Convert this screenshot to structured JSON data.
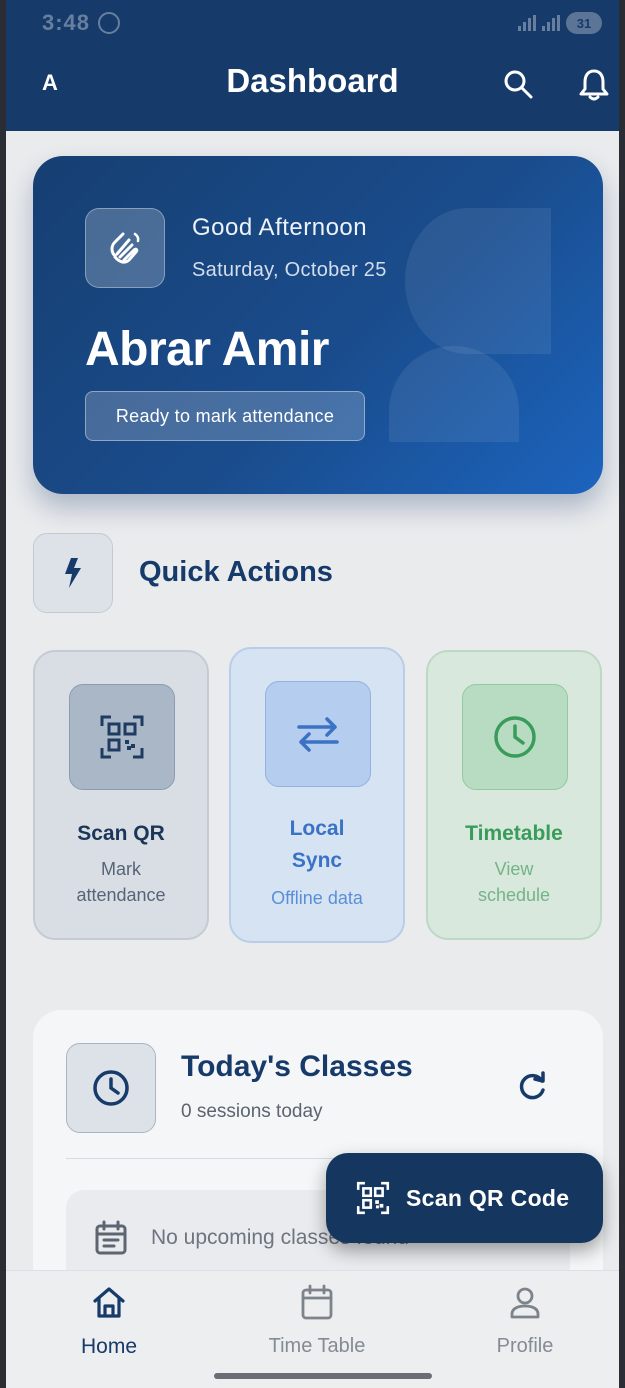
{
  "status_bar": {
    "time": "3:48",
    "battery": "31"
  },
  "app_bar": {
    "avatar_letter": "A",
    "title": "Dashboard"
  },
  "hero": {
    "greeting": "Good Afternoon",
    "date": "Saturday, October 25",
    "name": "Abrar Amir",
    "status_chip": "Ready to mark attendance"
  },
  "quick_actions": {
    "title": "Quick Actions",
    "items": [
      {
        "title": "Scan QR",
        "subtitle_line1": "Mark",
        "subtitle_line2": "attendance",
        "icon": "qr-scan-icon"
      },
      {
        "title_line1": "Local",
        "title_line2": "Sync",
        "subtitle": "Offline data",
        "icon": "sync-arrows-icon"
      },
      {
        "title": "Timetable",
        "subtitle_line1": "View",
        "subtitle_line2": "schedule",
        "icon": "clock-icon"
      }
    ]
  },
  "classes": {
    "title": "Today's Classes",
    "subtitle": "0 sessions today",
    "empty_text": "No upcoming classes found"
  },
  "fab": {
    "label": "Scan QR Code"
  },
  "bottom_nav": [
    {
      "label": "Home",
      "icon": "home-icon",
      "active": true
    },
    {
      "label": "Time Table",
      "icon": "calendar-icon",
      "active": false
    },
    {
      "label": "Profile",
      "icon": "person-icon",
      "active": false
    }
  ],
  "colors": {
    "primary": "#163a6a",
    "sync_accent": "#3a72c4",
    "timetable_accent": "#3a9c5a"
  }
}
